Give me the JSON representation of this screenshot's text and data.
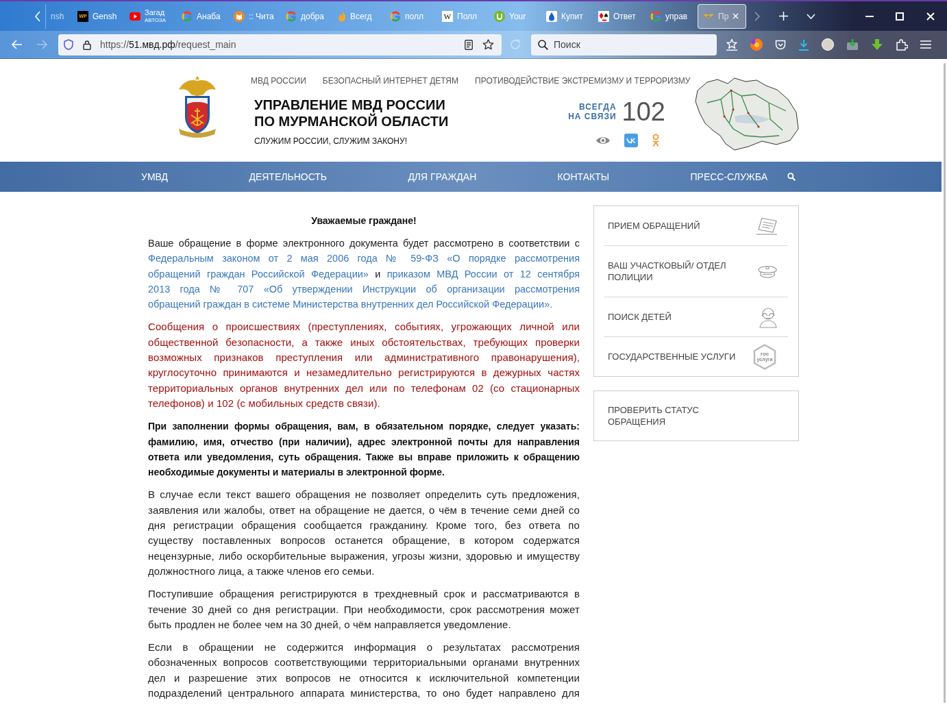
{
  "browser": {
    "tabs": [
      {
        "kind": "cut",
        "title": "nsh",
        "selected": false
      },
      {
        "kind": "dark_tile",
        "mark": "WP",
        "title": "Gensh",
        "selected": false
      },
      {
        "kind": "play",
        "title": "Загад",
        "subtitle": "АВТОЗА",
        "selected": false
      },
      {
        "kind": "ring",
        "title": "Анаба",
        "selected": false
      },
      {
        "kind": "book",
        "title": ":: Чита",
        "selected": false
      },
      {
        "kind": "ring",
        "title": "добра",
        "selected": false
      },
      {
        "kind": "flame",
        "title": "Всегд",
        "selected": false
      },
      {
        "kind": "ring",
        "title": "полл",
        "selected": false
      },
      {
        "kind": "light_tile",
        "mark": "W",
        "title": "Полл",
        "selected": false
      },
      {
        "kind": "badge",
        "title": "Your",
        "selected": false
      },
      {
        "kind": "drop",
        "title": "Купит",
        "selected": false
      },
      {
        "kind": "cards",
        "title": "Ответ",
        "selected": false
      },
      {
        "kind": "ring",
        "title": "управ",
        "selected": false
      },
      {
        "kind": "wings",
        "title": "Пр",
        "selected": true
      }
    ],
    "address": {
      "scheme": "https://",
      "host": "51.мвд.рф",
      "path": "/request_main"
    },
    "search": {
      "placeholder": "Поиск"
    }
  },
  "header": {
    "top_links": [
      "МВД РОССИИ",
      "БЕЗОПАСНЫЙ ИНТЕРНЕТ ДЕТЯМ",
      "ПРОТИВОДЕЙСТВИЕ ЭКСТРЕМИЗМУ И ТЕРРОРИЗМУ"
    ],
    "title_lines": [
      "УПРАВЛЕНИЕ МВД РОССИИ",
      "ПО МУРМАНСКОЙ ОБЛАСТИ"
    ],
    "slogan": "СЛУЖИМ РОССИИ, СЛУЖИМ ЗАКОНУ!",
    "hotline_label_lines": [
      "ВСЕГДА",
      "НА СВЯЗИ"
    ],
    "hotline_number": "102"
  },
  "nav": {
    "items": [
      "УМВД",
      "ДЕЯТЕЛЬНОСТЬ",
      "ДЛЯ ГРАЖДАН",
      "КОНТАКТЫ",
      "ПРЕСС-СЛУЖБА"
    ]
  },
  "content": {
    "heading": "Уважаемые граждане!",
    "paragraphs": [
      {
        "kind": "mixed",
        "parts": [
          {
            "kind": "text",
            "text": "Ваше обращение в форме электронного документа будет рассмотрено в соответствии с"
          },
          {
            "kind": "link",
            "text": "Федеральным законом от 2 мая 2006 года № 59-ФЗ «О порядке рассмотрения"
          },
          {
            "kind": "link",
            "text": "обращений граждан Российской Федерации»"
          },
          {
            "kind": "text",
            "text": "и"
          },
          {
            "kind": "link",
            "text": "приказом МВД России от 12 сентября"
          },
          {
            "kind": "link",
            "text": "2013 года № 707 «Об утверждении Инструкции об организации рассмотрения"
          },
          {
            "kind": "link",
            "text": "обращений граждан в системе Министерства внутренних дел Российской Федерации»."
          }
        ]
      },
      {
        "kind": "alert",
        "text": "Сообщения о происшествиях (преступлениях, событиях, угрожающих личной или общественной безопасности, а также иных обстоятельствах, требующих проверки возможных признаков преступления или административного правонарушения), круглосуточно принимаются и незамедлительно регистрируются в дежурных частях территориальных органов внутренних дел или по телефонам 02 (со стационарных телефонов) и 102 (с мобильных средств связи)."
      },
      {
        "kind": "bold",
        "text": "При заполнении формы обращения, вам, в обязательном порядке, следует указать: фамилию, имя, отчество (при наличии), адрес электронной почты для направления ответа или уведомления, суть обращения. Также вы вправе приложить к обращению необходимые документы и материалы в электронной форме."
      },
      {
        "kind": "plain",
        "text": "В случае если текст вашего обращения не позволяет определить суть предложения, заявления или жалобы, ответ на обращение не дается, о чём в течение семи дней со дня регистрации обращения сообщается гражданину. Кроме того, без ответа по существу поставленных вопросов останется обращение, в котором содержатся нецензурные, либо оскорбительные выражения, угрозы жизни, здоровью и имуществу должностного лица, а также членов его семьи."
      },
      {
        "kind": "plain",
        "text": "Поступившие обращения регистрируются в трехдневный срок и рассматриваются в течение 30 дней со дня регистрации. При необходимости, срок рассмотрения может быть продлен не более чем на 30 дней, о чём направляется уведомление."
      },
      {
        "kind": "plain",
        "continues": true,
        "text": "Если в обращении не содержится информация о результатах рассмотрения обозначенных вопросов соответствующими территориальными органами внутренних дел и разрешение этих вопросов не относится к исключительной компетенции подразделений центрального аппарата министерства, то оно будет направлено для"
      }
    ]
  },
  "sidebar": {
    "services": [
      {
        "kind": "document",
        "label": "ПРИЕМ ОБРАЩЕНИЙ"
      },
      {
        "kind": "cap",
        "label": "ВАШ УЧАСТКОВЫЙ/ ОТДЕЛ ПОЛИЦИИ"
      },
      {
        "kind": "eyes",
        "label": "ПОИСК ДЕТЕЙ"
      },
      {
        "kind": "hexagon",
        "label": "ГОСУДАРСТВЕННЫЕ УСЛУГИ",
        "logo_lines": [
          "гос",
          "услуги"
        ]
      }
    ],
    "status_link": "ПРОВЕРИТЬ СТАТУС ОБРАЩЕНИЯ"
  }
}
